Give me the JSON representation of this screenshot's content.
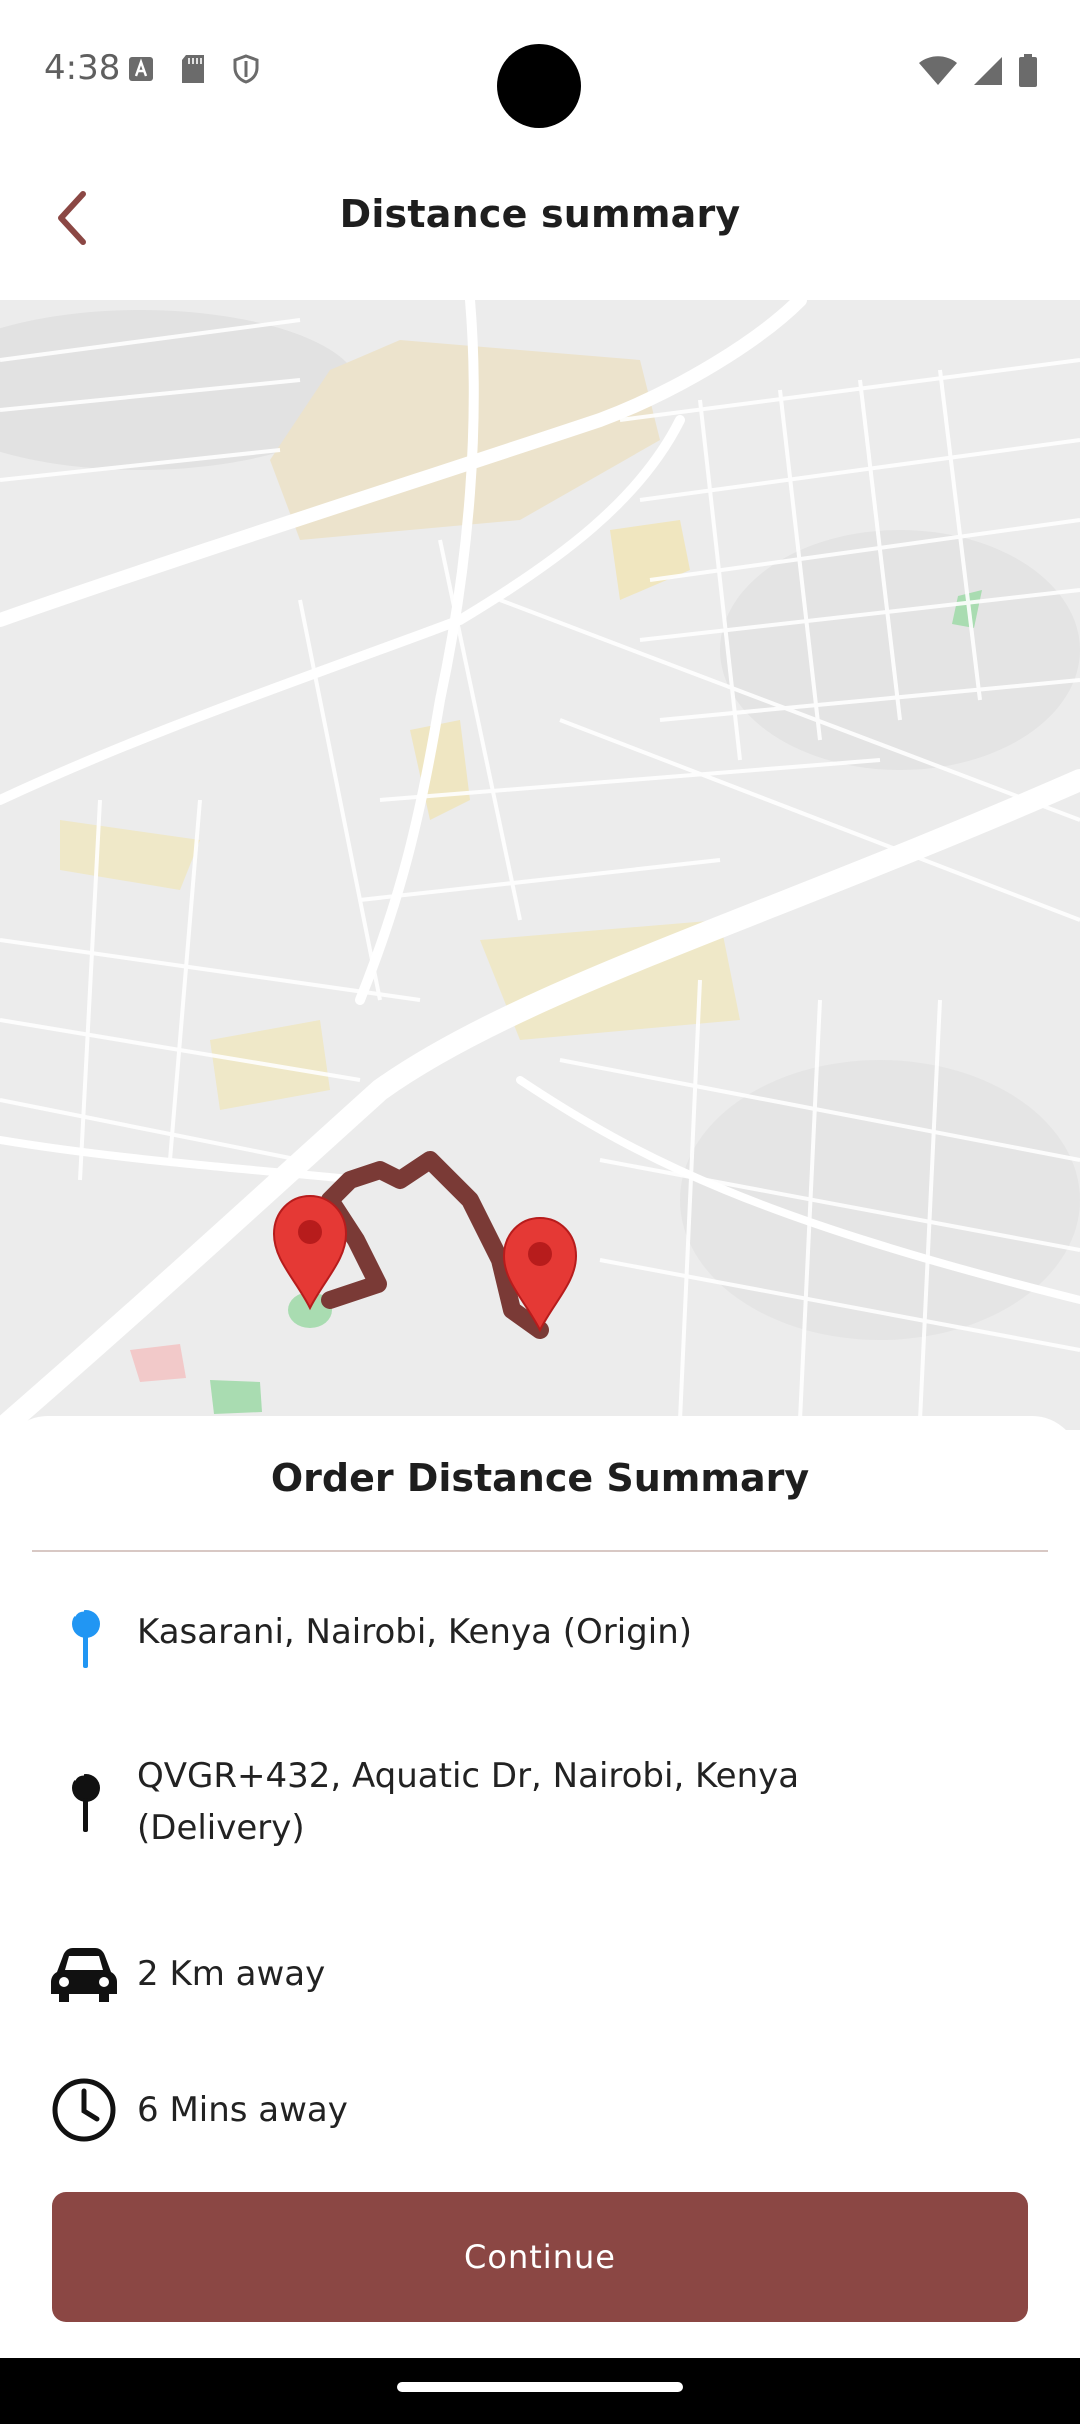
{
  "status_bar": {
    "time": "4:38",
    "left_icons": [
      "font-a-icon",
      "sd-card-icon",
      "shield-icon"
    ],
    "right_icons": [
      "wifi-icon",
      "signal-icon",
      "battery-icon"
    ]
  },
  "header": {
    "title": "Distance summary",
    "back_icon": "chevron-left-icon"
  },
  "map": {
    "route_color": "#7a3a36",
    "marker_color": "#e53935",
    "markers": [
      "origin-marker",
      "delivery-marker"
    ]
  },
  "sheet": {
    "title": "Order Distance Summary",
    "rows": [
      {
        "icon": "map-pin-blue-icon",
        "text": "Kasarani, Nairobi, Kenya (Origin)"
      },
      {
        "icon": "map-pin-black-icon",
        "text": "QVGR+432, Aquatic Dr, Nairobi, Kenya (Delivery)"
      },
      {
        "icon": "car-icon",
        "text": "2 Km away"
      },
      {
        "icon": "clock-icon",
        "text": "6 Mins away"
      }
    ]
  },
  "continue_button": {
    "label": "Continue",
    "color": "#8b4744"
  },
  "colors": {
    "accent": "#8b4744",
    "origin_pin": "#2196f3"
  }
}
